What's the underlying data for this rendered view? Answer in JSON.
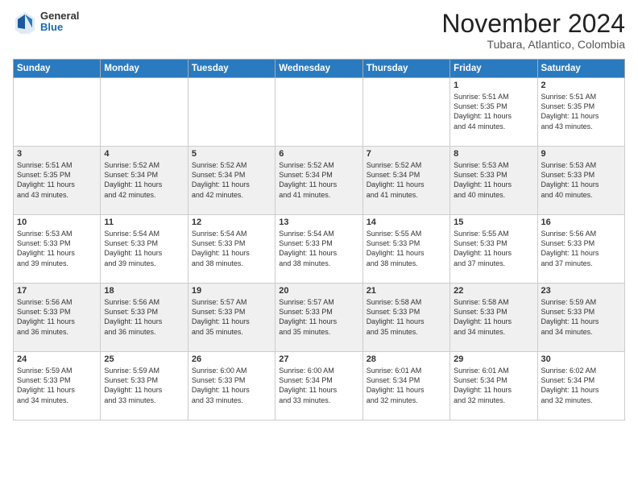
{
  "header": {
    "logo": {
      "general": "General",
      "blue": "Blue"
    },
    "title": "November 2024",
    "location": "Tubara, Atlantico, Colombia"
  },
  "weekdays": [
    "Sunday",
    "Monday",
    "Tuesday",
    "Wednesday",
    "Thursday",
    "Friday",
    "Saturday"
  ],
  "weeks": [
    [
      {
        "day": "",
        "info": ""
      },
      {
        "day": "",
        "info": ""
      },
      {
        "day": "",
        "info": ""
      },
      {
        "day": "",
        "info": ""
      },
      {
        "day": "",
        "info": ""
      },
      {
        "day": "1",
        "info": "Sunrise: 5:51 AM\nSunset: 5:35 PM\nDaylight: 11 hours\nand 44 minutes."
      },
      {
        "day": "2",
        "info": "Sunrise: 5:51 AM\nSunset: 5:35 PM\nDaylight: 11 hours\nand 43 minutes."
      }
    ],
    [
      {
        "day": "3",
        "info": "Sunrise: 5:51 AM\nSunset: 5:35 PM\nDaylight: 11 hours\nand 43 minutes."
      },
      {
        "day": "4",
        "info": "Sunrise: 5:52 AM\nSunset: 5:34 PM\nDaylight: 11 hours\nand 42 minutes."
      },
      {
        "day": "5",
        "info": "Sunrise: 5:52 AM\nSunset: 5:34 PM\nDaylight: 11 hours\nand 42 minutes."
      },
      {
        "day": "6",
        "info": "Sunrise: 5:52 AM\nSunset: 5:34 PM\nDaylight: 11 hours\nand 41 minutes."
      },
      {
        "day": "7",
        "info": "Sunrise: 5:52 AM\nSunset: 5:34 PM\nDaylight: 11 hours\nand 41 minutes."
      },
      {
        "day": "8",
        "info": "Sunrise: 5:53 AM\nSunset: 5:33 PM\nDaylight: 11 hours\nand 40 minutes."
      },
      {
        "day": "9",
        "info": "Sunrise: 5:53 AM\nSunset: 5:33 PM\nDaylight: 11 hours\nand 40 minutes."
      }
    ],
    [
      {
        "day": "10",
        "info": "Sunrise: 5:53 AM\nSunset: 5:33 PM\nDaylight: 11 hours\nand 39 minutes."
      },
      {
        "day": "11",
        "info": "Sunrise: 5:54 AM\nSunset: 5:33 PM\nDaylight: 11 hours\nand 39 minutes."
      },
      {
        "day": "12",
        "info": "Sunrise: 5:54 AM\nSunset: 5:33 PM\nDaylight: 11 hours\nand 38 minutes."
      },
      {
        "day": "13",
        "info": "Sunrise: 5:54 AM\nSunset: 5:33 PM\nDaylight: 11 hours\nand 38 minutes."
      },
      {
        "day": "14",
        "info": "Sunrise: 5:55 AM\nSunset: 5:33 PM\nDaylight: 11 hours\nand 38 minutes."
      },
      {
        "day": "15",
        "info": "Sunrise: 5:55 AM\nSunset: 5:33 PM\nDaylight: 11 hours\nand 37 minutes."
      },
      {
        "day": "16",
        "info": "Sunrise: 5:56 AM\nSunset: 5:33 PM\nDaylight: 11 hours\nand 37 minutes."
      }
    ],
    [
      {
        "day": "17",
        "info": "Sunrise: 5:56 AM\nSunset: 5:33 PM\nDaylight: 11 hours\nand 36 minutes."
      },
      {
        "day": "18",
        "info": "Sunrise: 5:56 AM\nSunset: 5:33 PM\nDaylight: 11 hours\nand 36 minutes."
      },
      {
        "day": "19",
        "info": "Sunrise: 5:57 AM\nSunset: 5:33 PM\nDaylight: 11 hours\nand 35 minutes."
      },
      {
        "day": "20",
        "info": "Sunrise: 5:57 AM\nSunset: 5:33 PM\nDaylight: 11 hours\nand 35 minutes."
      },
      {
        "day": "21",
        "info": "Sunrise: 5:58 AM\nSunset: 5:33 PM\nDaylight: 11 hours\nand 35 minutes."
      },
      {
        "day": "22",
        "info": "Sunrise: 5:58 AM\nSunset: 5:33 PM\nDaylight: 11 hours\nand 34 minutes."
      },
      {
        "day": "23",
        "info": "Sunrise: 5:59 AM\nSunset: 5:33 PM\nDaylight: 11 hours\nand 34 minutes."
      }
    ],
    [
      {
        "day": "24",
        "info": "Sunrise: 5:59 AM\nSunset: 5:33 PM\nDaylight: 11 hours\nand 34 minutes."
      },
      {
        "day": "25",
        "info": "Sunrise: 5:59 AM\nSunset: 5:33 PM\nDaylight: 11 hours\nand 33 minutes."
      },
      {
        "day": "26",
        "info": "Sunrise: 6:00 AM\nSunset: 5:33 PM\nDaylight: 11 hours\nand 33 minutes."
      },
      {
        "day": "27",
        "info": "Sunrise: 6:00 AM\nSunset: 5:34 PM\nDaylight: 11 hours\nand 33 minutes."
      },
      {
        "day": "28",
        "info": "Sunrise: 6:01 AM\nSunset: 5:34 PM\nDaylight: 11 hours\nand 32 minutes."
      },
      {
        "day": "29",
        "info": "Sunrise: 6:01 AM\nSunset: 5:34 PM\nDaylight: 11 hours\nand 32 minutes."
      },
      {
        "day": "30",
        "info": "Sunrise: 6:02 AM\nSunset: 5:34 PM\nDaylight: 11 hours\nand 32 minutes."
      }
    ]
  ]
}
